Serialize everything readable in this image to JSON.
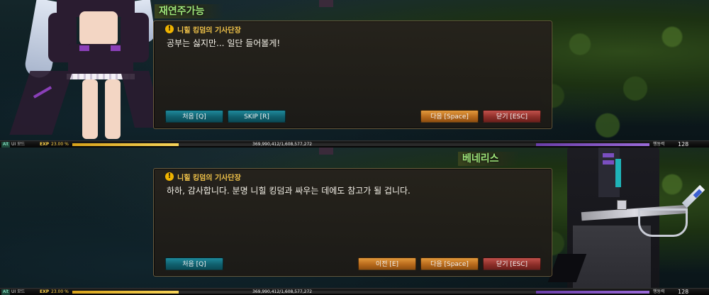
{
  "panels": [
    {
      "name_tag": "재연주가능",
      "dialog_title": "니힐 킹덤의 기사단장",
      "dialog_text": "공부는 싫지만... 일단 들어볼게!",
      "buttons": {
        "first": "처음 [Q]",
        "skip": "SKIP [R]",
        "next": "다음 [Space]",
        "close": "닫기 [ESC]"
      }
    },
    {
      "name_tag": "베네리스",
      "dialog_title": "니힐 킹덤의 기사단장",
      "dialog_text": "하하, 감사합니다. 분명 니힐 킹덤과 싸우는 데에도 참고가 될 겁니다.",
      "buttons": {
        "first": "처음 [Q]",
        "prev": "이전 [E]",
        "next": "다음 [Space]",
        "close": "닫기 [ESC]"
      }
    }
  ],
  "hud": {
    "alt_key": "Alt",
    "ui_mode": "UI 모드",
    "exp_label": "EXP",
    "exp_percent": "23.00 %",
    "exp_fraction": 0.23,
    "exp_numbers": "369,990,412/1,608,577,272",
    "stamina_label": "행동력",
    "stamina_value": "128"
  },
  "colors": {
    "name_green": "#9ee57a",
    "title_gold": "#f2c44a",
    "teal_button": "#1f8a9c",
    "orange_button": "#e39a3c",
    "red_button": "#c2514b"
  }
}
